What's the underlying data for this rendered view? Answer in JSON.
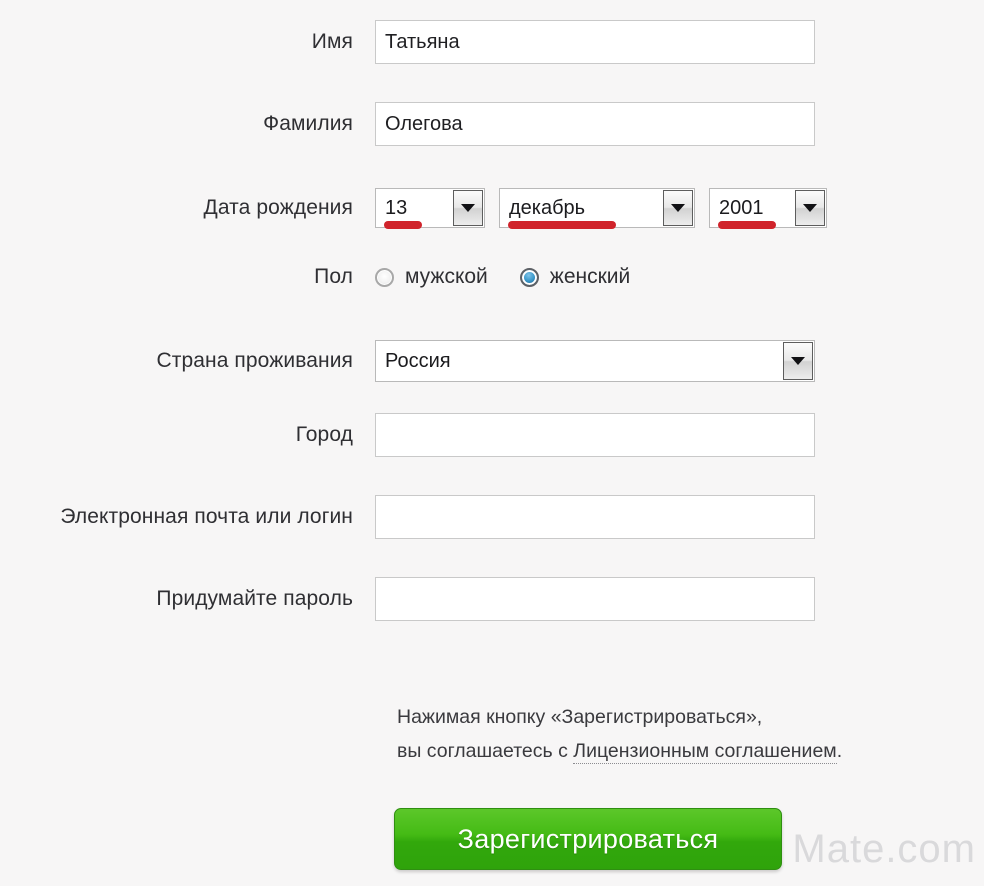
{
  "page": {
    "background_color": "#f7f6f6",
    "accent_green": "#3caf11",
    "annotation_red": "#d0232b",
    "radio_selected_blue": "#2c7fb0"
  },
  "fields": {
    "first_name": {
      "label": "Имя",
      "value": "Татьяна",
      "placeholder": ""
    },
    "last_name": {
      "label": "Фамилия",
      "value": "Олегова",
      "placeholder": ""
    },
    "birth_date": {
      "label": "Дата рождения",
      "day": "13",
      "month": "декабрь",
      "year": "2001"
    },
    "gender": {
      "label": "Пол",
      "options": [
        {
          "label": "мужской",
          "selected": false
        },
        {
          "label": "женский",
          "selected": true
        }
      ]
    },
    "country": {
      "label": "Страна проживания",
      "value": "Россия"
    },
    "city": {
      "label": "Город",
      "value": "",
      "placeholder": ""
    },
    "email": {
      "label": "Электронная почта или логин",
      "value": "",
      "placeholder": ""
    },
    "password": {
      "label": "Придумайте пароль",
      "value": "",
      "placeholder": ""
    }
  },
  "agreement": {
    "line1": "Нажимая кнопку «Зарегистрироваться»,",
    "line2_prefix": "вы соглашаетесь с ",
    "license_link": "Лицензионным соглашением",
    "line2_suffix": "."
  },
  "submit": {
    "label": "Зарегистрироваться"
  },
  "watermark": {
    "text": "Mate.com"
  },
  "icons": {
    "dropdown_arrow": "chevron-down-icon"
  }
}
